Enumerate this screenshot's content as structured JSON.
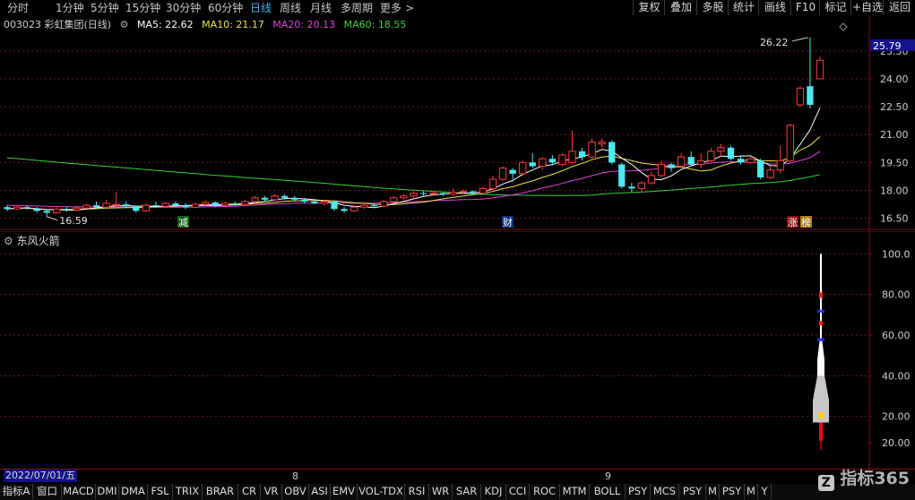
{
  "toolbar": {
    "periods": [
      {
        "label": "分时",
        "active": false
      },
      {
        "label": "1分钟",
        "active": false
      },
      {
        "label": "5分钟",
        "active": false
      },
      {
        "label": "15分钟",
        "active": false
      },
      {
        "label": "30分钟",
        "active": false
      },
      {
        "label": "60分钟",
        "active": false
      },
      {
        "label": "日线",
        "active": true
      },
      {
        "label": "周线",
        "active": false
      },
      {
        "label": "月线",
        "active": false
      },
      {
        "label": "多周期",
        "active": false
      },
      {
        "label": "更多",
        "active": false
      }
    ],
    "more_arrow": ">",
    "buttons": [
      "复权",
      "叠加",
      "多股",
      "统计",
      "画线",
      "F10",
      "标记",
      "+自选",
      "返回"
    ]
  },
  "info": {
    "stock": "003023 彩虹集团(日线)",
    "ma5": "MA5: 22.62",
    "ma10": "MA10: 21.17",
    "ma20": "MA20: 20.13",
    "ma60": "MA60: 18.55"
  },
  "main_axis": {
    "current_price": "25.79",
    "ticks": [
      "25.50",
      "24.00",
      "22.50",
      "21.00",
      "19.50",
      "18.00",
      "16.50"
    ],
    "high_label": "26.22",
    "low_label": "16.59"
  },
  "markers": {
    "m1": "减",
    "m2": "财",
    "m3": "涨",
    "m4": "榜"
  },
  "lower": {
    "title": "东风火箭",
    "ticks": [
      "100.0",
      "80.00",
      "60.00",
      "40.00",
      "20.00",
      "20.00"
    ]
  },
  "date_strip": {
    "start": "2022/07/01/五",
    "m8": "8",
    "m9": "9"
  },
  "bottom_tabs": [
    "指标A",
    "窗口",
    "MACD",
    "DMI",
    "DMA",
    "FSL",
    "TRIX",
    "BRAR",
    "CR",
    "VR",
    "OBV",
    "ASI",
    "EMV",
    "VOL-TDX",
    "RSI",
    "WR",
    "SAR",
    "KDJ",
    "CCI",
    "ROC",
    "MTM",
    "BOLL",
    "PSY",
    "MCS",
    "PSY",
    "M",
    "PSY",
    "M",
    "Y"
  ],
  "watermark": "指标365",
  "colors": {
    "up": "#ff3b3b",
    "down": "#4fe8f0",
    "ma5": "#ffffff",
    "ma10": "#f0e24a",
    "ma20": "#e040e0",
    "ma60": "#3ad13a",
    "active": "#2fb8ff"
  },
  "chart_data": {
    "type": "candlestick",
    "ylim": [
      16.0,
      26.6
    ],
    "candles": [
      {
        "o": 17.1,
        "c": 17.0,
        "h": 17.2,
        "l": 16.9
      },
      {
        "o": 17.0,
        "c": 17.1,
        "h": 17.2,
        "l": 16.95
      },
      {
        "o": 17.1,
        "c": 17.05,
        "h": 17.2,
        "l": 16.95
      },
      {
        "o": 17.0,
        "c": 16.9,
        "h": 17.1,
        "l": 16.8
      },
      {
        "o": 16.9,
        "c": 16.8,
        "h": 17.0,
        "l": 16.59
      },
      {
        "o": 16.8,
        "c": 17.0,
        "h": 17.1,
        "l": 16.75
      },
      {
        "o": 17.0,
        "c": 16.95,
        "h": 17.1,
        "l": 16.85
      },
      {
        "o": 16.95,
        "c": 17.05,
        "h": 17.15,
        "l": 16.9
      },
      {
        "o": 17.05,
        "c": 17.2,
        "h": 17.3,
        "l": 17.0
      },
      {
        "o": 17.2,
        "c": 17.1,
        "h": 17.4,
        "l": 17.0
      },
      {
        "o": 17.1,
        "c": 17.3,
        "h": 17.5,
        "l": 17.05
      },
      {
        "o": 17.2,
        "c": 17.25,
        "h": 17.9,
        "l": 17.1
      },
      {
        "o": 17.25,
        "c": 17.15,
        "h": 17.4,
        "l": 17.05
      },
      {
        "o": 17.15,
        "c": 16.9,
        "h": 17.2,
        "l": 16.8
      },
      {
        "o": 16.9,
        "c": 17.2,
        "h": 17.3,
        "l": 16.85
      },
      {
        "o": 17.2,
        "c": 17.15,
        "h": 17.4,
        "l": 17.05
      },
      {
        "o": 17.15,
        "c": 17.3,
        "h": 17.4,
        "l": 17.1
      },
      {
        "o": 17.3,
        "c": 17.2,
        "h": 17.4,
        "l": 17.1
      },
      {
        "o": 17.2,
        "c": 17.1,
        "h": 17.3,
        "l": 17.0
      },
      {
        "o": 17.1,
        "c": 17.25,
        "h": 17.35,
        "l": 17.05
      },
      {
        "o": 17.25,
        "c": 17.35,
        "h": 17.45,
        "l": 17.15
      },
      {
        "o": 17.35,
        "c": 17.2,
        "h": 17.4,
        "l": 17.1
      },
      {
        "o": 17.2,
        "c": 17.3,
        "h": 17.4,
        "l": 17.1
      },
      {
        "o": 17.3,
        "c": 17.25,
        "h": 17.4,
        "l": 17.15
      },
      {
        "o": 17.25,
        "c": 17.4,
        "h": 17.5,
        "l": 17.2
      },
      {
        "o": 17.4,
        "c": 17.6,
        "h": 17.7,
        "l": 17.3
      },
      {
        "o": 17.6,
        "c": 17.5,
        "h": 17.7,
        "l": 17.4
      },
      {
        "o": 17.5,
        "c": 17.7,
        "h": 17.8,
        "l": 17.45
      },
      {
        "o": 17.7,
        "c": 17.6,
        "h": 17.8,
        "l": 17.5
      },
      {
        "o": 17.6,
        "c": 17.5,
        "h": 17.7,
        "l": 17.4
      },
      {
        "o": 17.5,
        "c": 17.4,
        "h": 17.6,
        "l": 17.3
      },
      {
        "o": 17.4,
        "c": 17.3,
        "h": 17.5,
        "l": 17.25
      },
      {
        "o": 17.3,
        "c": 17.4,
        "h": 17.5,
        "l": 17.2
      },
      {
        "o": 17.4,
        "c": 17.0,
        "h": 17.45,
        "l": 16.9
      },
      {
        "o": 17.0,
        "c": 16.9,
        "h": 17.1,
        "l": 16.8
      },
      {
        "o": 16.9,
        "c": 17.1,
        "h": 17.2,
        "l": 16.85
      },
      {
        "o": 17.1,
        "c": 17.2,
        "h": 17.3,
        "l": 17.0
      },
      {
        "o": 17.2,
        "c": 17.15,
        "h": 17.3,
        "l": 17.1
      },
      {
        "o": 17.15,
        "c": 17.4,
        "h": 17.5,
        "l": 17.1
      },
      {
        "o": 17.4,
        "c": 17.6,
        "h": 17.7,
        "l": 17.3
      },
      {
        "o": 17.6,
        "c": 17.7,
        "h": 17.8,
        "l": 17.5
      },
      {
        "o": 17.7,
        "c": 17.85,
        "h": 17.95,
        "l": 17.6
      },
      {
        "o": 17.85,
        "c": 17.8,
        "h": 17.95,
        "l": 17.7
      },
      {
        "o": 17.8,
        "c": 17.85,
        "h": 17.95,
        "l": 17.75
      },
      {
        "o": 17.85,
        "c": 17.8,
        "h": 17.9,
        "l": 17.7
      },
      {
        "o": 17.8,
        "c": 17.9,
        "h": 18.1,
        "l": 17.7
      },
      {
        "o": 17.9,
        "c": 17.95,
        "h": 18.05,
        "l": 17.8
      },
      {
        "o": 17.95,
        "c": 17.85,
        "h": 18.0,
        "l": 17.75
      },
      {
        "o": 17.85,
        "c": 18.1,
        "h": 18.2,
        "l": 17.8
      },
      {
        "o": 18.1,
        "c": 18.6,
        "h": 18.8,
        "l": 18.0
      },
      {
        "o": 18.6,
        "c": 19.2,
        "h": 19.3,
        "l": 18.5
      },
      {
        "o": 19.1,
        "c": 18.9,
        "h": 19.2,
        "l": 18.6
      },
      {
        "o": 18.9,
        "c": 19.5,
        "h": 19.6,
        "l": 18.8
      },
      {
        "o": 19.5,
        "c": 19.3,
        "h": 20.0,
        "l": 19.2
      },
      {
        "o": 19.3,
        "c": 19.7,
        "h": 19.8,
        "l": 19.1
      },
      {
        "o": 19.7,
        "c": 19.5,
        "h": 19.9,
        "l": 19.4
      },
      {
        "o": 19.4,
        "c": 19.9,
        "h": 20.0,
        "l": 19.3
      },
      {
        "o": 19.5,
        "c": 20.1,
        "h": 21.2,
        "l": 19.4
      },
      {
        "o": 20.1,
        "c": 19.8,
        "h": 20.3,
        "l": 19.6
      },
      {
        "o": 19.8,
        "c": 20.6,
        "h": 20.8,
        "l": 19.7
      },
      {
        "o": 20.5,
        "c": 20.6,
        "h": 20.8,
        "l": 20.3
      },
      {
        "o": 20.6,
        "c": 19.5,
        "h": 20.7,
        "l": 19.4
      },
      {
        "o": 19.4,
        "c": 18.2,
        "h": 19.5,
        "l": 18.1
      },
      {
        "o": 18.2,
        "c": 18.1,
        "h": 18.4,
        "l": 17.9
      },
      {
        "o": 18.1,
        "c": 18.4,
        "h": 18.5,
        "l": 17.95
      },
      {
        "o": 18.4,
        "c": 18.8,
        "h": 19.0,
        "l": 18.3
      },
      {
        "o": 18.8,
        "c": 19.4,
        "h": 19.6,
        "l": 18.7
      },
      {
        "o": 19.4,
        "c": 19.2,
        "h": 19.5,
        "l": 19.0
      },
      {
        "o": 19.3,
        "c": 19.8,
        "h": 20.0,
        "l": 19.2
      },
      {
        "o": 19.8,
        "c": 19.4,
        "h": 20.1,
        "l": 19.3
      },
      {
        "o": 19.4,
        "c": 19.6,
        "h": 20.0,
        "l": 19.2
      },
      {
        "o": 19.6,
        "c": 20.1,
        "h": 20.3,
        "l": 19.5
      },
      {
        "o": 20.1,
        "c": 20.3,
        "h": 20.5,
        "l": 19.8
      },
      {
        "o": 20.3,
        "c": 19.7,
        "h": 20.4,
        "l": 19.6
      },
      {
        "o": 19.7,
        "c": 19.5,
        "h": 19.9,
        "l": 19.4
      },
      {
        "o": 19.5,
        "c": 19.7,
        "h": 19.8,
        "l": 19.4
      },
      {
        "o": 19.6,
        "c": 18.7,
        "h": 19.7,
        "l": 18.6
      },
      {
        "o": 18.7,
        "c": 19.1,
        "h": 19.3,
        "l": 18.6
      },
      {
        "o": 19.1,
        "c": 19.6,
        "h": 20.4,
        "l": 18.9
      },
      {
        "o": 19.6,
        "c": 21.5,
        "h": 21.6,
        "l": 19.5
      },
      {
        "o": 22.6,
        "c": 23.5,
        "h": 23.6,
        "l": 22.5
      },
      {
        "o": 23.6,
        "c": 22.6,
        "h": 26.22,
        "l": 22.4
      },
      {
        "o": 24.0,
        "c": 25.0,
        "h": 25.2,
        "l": 24.0
      }
    ],
    "ma_periods": {
      "ma5": 5,
      "ma10": 10,
      "ma20": 20,
      "ma60": 60
    },
    "indicator": {
      "name": "东风火箭",
      "ylim": [
        0,
        105
      ],
      "rocket_top": 100.0,
      "rocket_bottom": 8.0
    }
  }
}
